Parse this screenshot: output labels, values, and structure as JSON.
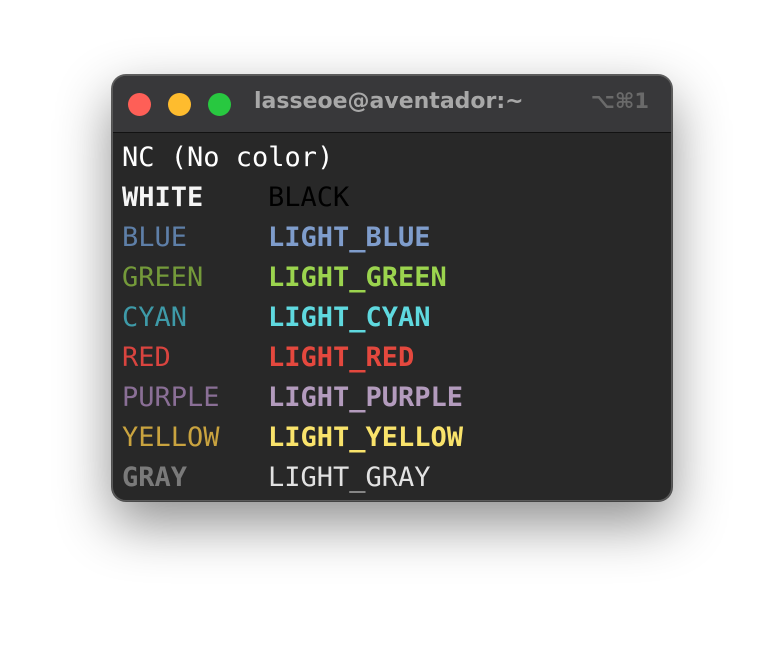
{
  "window": {
    "title": "lasseoe@aventador:~",
    "shortcut": "⌥⌘1"
  },
  "terminal": {
    "header_line": {
      "text": "NC (No color)",
      "color": "#ffffff"
    },
    "rows": [
      {
        "left": "WHITE",
        "left_color": "#f5f5f5",
        "right": "BLACK",
        "right_color": "#000000"
      },
      {
        "left": "BLUE",
        "left_color": "#5e7fa8",
        "right": "LIGHT_BLUE",
        "right_color": "#7f9dcc"
      },
      {
        "left": "GREEN",
        "left_color": "#749a3a",
        "right": "LIGHT_GREEN",
        "right_color": "#9bd44e"
      },
      {
        "left": "CYAN",
        "left_color": "#3e9aa8",
        "right": "LIGHT_CYAN",
        "right_color": "#5fd9df"
      },
      {
        "left": "RED",
        "left_color": "#d9443f",
        "right": "LIGHT_RED",
        "right_color": "#e4483e"
      },
      {
        "left": "PURPLE",
        "left_color": "#8a6f96",
        "right": "LIGHT_PURPLE",
        "right_color": "#b39bbd"
      },
      {
        "left": "YELLOW",
        "left_color": "#c9a33f",
        "right": "LIGHT_YELLOW",
        "right_color": "#f9e36b"
      },
      {
        "left": "GRAY",
        "left_color": "#7a7a7a",
        "right": "LIGHT_GRAY",
        "right_color": "#e2e2e2"
      }
    ]
  }
}
